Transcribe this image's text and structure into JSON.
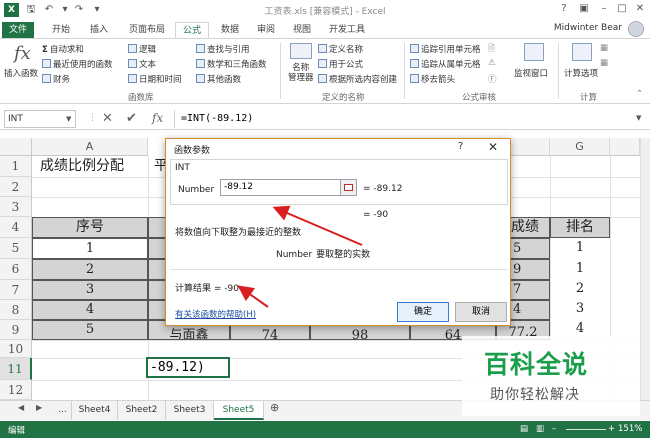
{
  "window": {
    "title": "工资表.xls [兼容模式] - Excel",
    "app_icon": "X",
    "help": "?",
    "user": "Midwinter Bear"
  },
  "tabs": [
    "文件",
    "开始",
    "插入",
    "页面布局",
    "公式",
    "数据",
    "审阅",
    "视图",
    "开发工具"
  ],
  "active_tab": "公式",
  "ribbon": {
    "insert_function": "插入函数",
    "g1": [
      "自动求和",
      "最近使用的函数",
      "财务"
    ],
    "g2": [
      "逻辑",
      "文本",
      "日期和时间"
    ],
    "g3": [
      "查找与引用",
      "数学和三角函数",
      "其他函数"
    ],
    "group_library": "函数库",
    "name_manager": "名称\n管理器",
    "g4": [
      "定义名称",
      "用于公式",
      "根据所选内容创建"
    ],
    "group_names": "定义的名称",
    "g5": [
      "追踪引用单元格",
      "追踪从属单元格",
      "移去箭头"
    ],
    "watch": "监视窗口",
    "group_audit": "公式审核",
    "calc_options": "计算选项",
    "group_calc": "计算"
  },
  "formula_bar": {
    "name_box": "INT",
    "fx": "fx",
    "formula": "=INT(-89.12)"
  },
  "grid": {
    "columns": [
      "A",
      "G"
    ],
    "rows": [
      "1",
      "2",
      "3",
      "4",
      "5",
      "6",
      "7",
      "8",
      "9",
      "10",
      "11",
      "12"
    ],
    "title": "成绩比例分配",
    "b1_fragment": "平",
    "header_seq": "序号",
    "header_score_fragment": "成绩",
    "header_rank": "排名",
    "seq": [
      "1",
      "2",
      "3",
      "4",
      "5"
    ],
    "score_fragment": [
      "5",
      "9",
      "7",
      "4",
      "2"
    ],
    "rank": [
      "1",
      "1",
      "2",
      "3",
      "4"
    ],
    "row9_name": "与面鑫",
    "row9_c": "74",
    "row9_d": "98",
    "row9_e": "64",
    "row9_f": "77.2",
    "active_cell": "-89.12)"
  },
  "dialog": {
    "title": "函数参数",
    "help": "?",
    "close": "✕",
    "function_name": "INT",
    "arg_label": "Number",
    "arg_value": "-89.12",
    "arg_result": "=  -89.12",
    "formula_result_preview": "=  -90",
    "description": "将数值向下取整为最接近的整数",
    "arg_description_label": "Number",
    "arg_description": "要取整的实数",
    "calc_result": "计算结果 =   -90",
    "help_link": "有关该函数的帮助(H)",
    "ok": "确定",
    "cancel": "取消"
  },
  "sheets": {
    "ellipsis": "...",
    "tabs": [
      "Sheet4",
      "Sheet2",
      "Sheet3",
      "Sheet5"
    ],
    "active": "Sheet5"
  },
  "status": {
    "mode": "编辑",
    "zoom": "151%"
  },
  "watermark": {
    "main": "百科全说",
    "sub": "助你轻松解决"
  },
  "colors": {
    "excel_green": "#217346",
    "dialog_border": "#d68a31",
    "arrow_red": "#d81e1e",
    "watermark_green": "#1b9e4b"
  }
}
